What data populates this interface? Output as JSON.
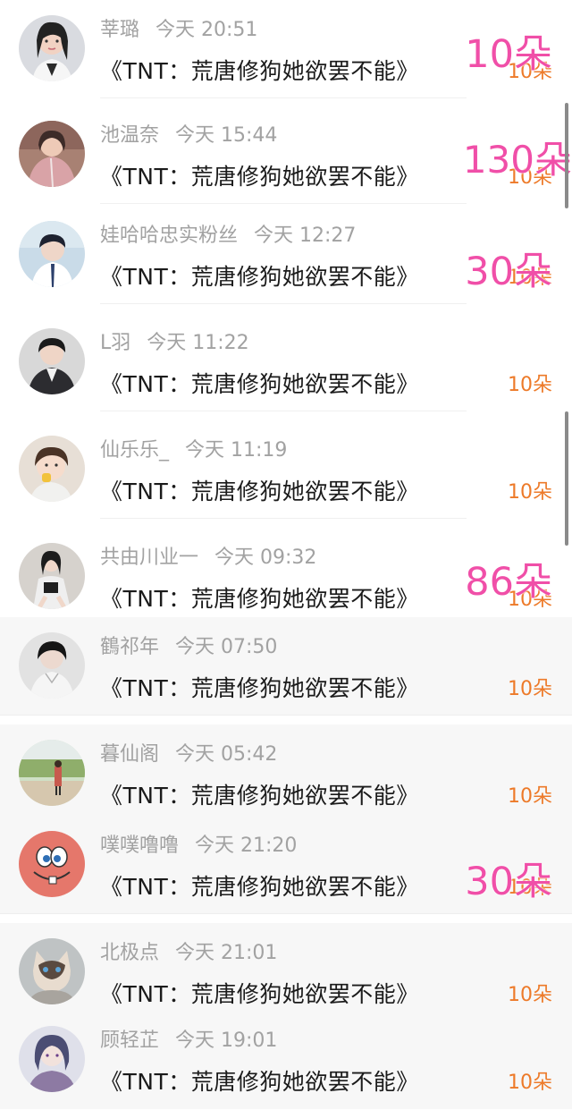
{
  "entries": [
    {
      "name": "莘璐",
      "time": "今天 20:51",
      "title": "《TNT：荒唐修狗她欲罢不能》",
      "amount": "10朵",
      "overlay": "10朵",
      "avatar_icon": "girl-portrait-avatar"
    },
    {
      "name": "池温奈",
      "time": "今天 15:44",
      "title": "《TNT：荒唐修狗她欲罢不能》",
      "amount": "10朵",
      "overlay": "130朵",
      "avatar_icon": "girl-pink-jacket-avatar"
    },
    {
      "name": "娃哈哈忠实粉丝",
      "time": "今天 12:27",
      "title": "《TNT：荒唐修狗她欲罢不能》",
      "amount": "10朵",
      "overlay": "30朵",
      "avatar_icon": "boy-portrait-avatar"
    },
    {
      "name": "L羽",
      "time": "今天 11:22",
      "title": "《TNT：荒唐修狗她欲罢不能》",
      "amount": "10朵",
      "overlay": "",
      "avatar_icon": "man-suit-avatar"
    },
    {
      "name": "仙乐乐_",
      "time": "今天 11:19",
      "title": "《TNT：荒唐修狗她欲罢不能》",
      "amount": "10朵",
      "overlay": "",
      "avatar_icon": "child-avatar"
    },
    {
      "name": "共由川业一",
      "time": "今天 09:32",
      "title": "《TNT：荒唐修狗她欲罢不能》",
      "amount": "10朵",
      "overlay": "86朵",
      "avatar_icon": "woman-pose-avatar"
    },
    {
      "name": "鶴祁年",
      "time": "今天 07:50",
      "title": "《TNT：荒唐修狗她欲罢不能》",
      "amount": "10朵",
      "overlay": "",
      "avatar_icon": "man-illustration-avatar"
    },
    {
      "name": "暮仙阁",
      "time": "今天 05:42",
      "title": "《TNT：荒唐修狗她欲罢不能》",
      "amount": "10朵",
      "overlay": "",
      "avatar_icon": "outdoor-scene-avatar"
    },
    {
      "name": "噗噗噜噜",
      "time": "今天 21:20",
      "title": "《TNT：荒唐修狗她欲罢不能》",
      "amount": "10朵",
      "overlay": "30朵",
      "avatar_icon": "cartoon-face-avatar"
    },
    {
      "name": "北极点",
      "time": "今天 21:01",
      "title": "《TNT：荒唐修狗她欲罢不能》",
      "amount": "10朵",
      "overlay": "",
      "avatar_icon": "cat-avatar"
    },
    {
      "name": "顾轻芷",
      "time": "今天 19:01",
      "title": "《TNT：荒唐修狗她欲罢不能》",
      "amount": "10朵",
      "overlay": "",
      "avatar_icon": "anime-character-avatar"
    }
  ],
  "colors": {
    "name": "#a2a2a2",
    "title": "#1b1b1b",
    "amount": "#ed7a29",
    "overlay": "#f04fa8"
  }
}
